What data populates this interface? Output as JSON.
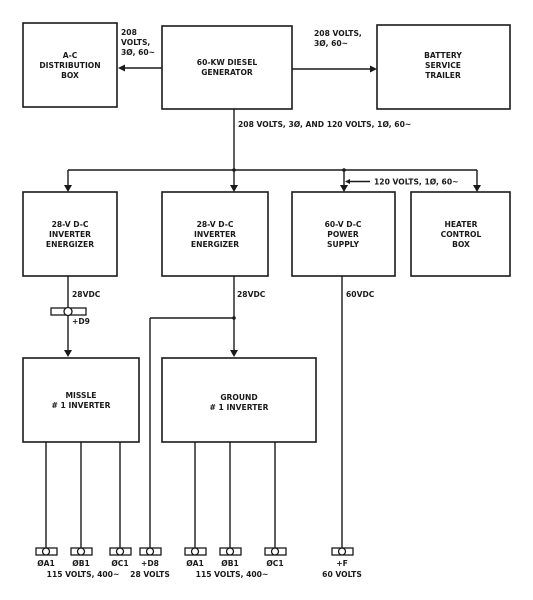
{
  "diagram": {
    "blocks": {
      "ac_box": [
        "A-C",
        "DISTRIBUTION",
        "BOX"
      ],
      "generator": [
        "60-KW DIESEL",
        "GENERATOR"
      ],
      "battery": [
        "BATTERY",
        "SERVICE",
        "TRAILER"
      ],
      "inverter_energizer_1": [
        "28-V D-C",
        "INVERTER",
        "ENERGIZER"
      ],
      "inverter_energizer_2": [
        "28-V D-C",
        "INVERTER",
        "ENERGIZER"
      ],
      "power_supply": [
        "60-V D-C",
        "POWER",
        "SUPPLY"
      ],
      "heater": [
        "HEATER",
        "CONTROL",
        "BOX"
      ],
      "missle_inverter": [
        "MISSLE",
        "# 1 INVERTER"
      ],
      "ground_inverter": [
        "GROUND",
        "# 1 INVERTER"
      ]
    },
    "labels": {
      "gen_to_ac": [
        "208",
        "VOLTS,",
        "3Ø, 60~"
      ],
      "gen_to_battery": [
        "208 VOLTS,",
        "3Ø, 60~"
      ],
      "main_bus": "208 VOLTS, 3Ø, AND 120 VOLTS, 1Ø, 60~",
      "power_supply_feed": "120 VOLTS, 1Ø, 60~",
      "energizer1_out": "28VDC",
      "energizer2_out": "28VDC",
      "power_supply_out": "60VDC",
      "d9_terminal": "+D9"
    },
    "terminals": [
      {
        "id": "missle-a1",
        "label": "ØA1"
      },
      {
        "id": "missle-b1",
        "label": "ØB1"
      },
      {
        "id": "missle-c1",
        "label": "ØC1"
      },
      {
        "id": "d8",
        "label": "+D8"
      },
      {
        "id": "ground-a1",
        "label": "ØA1"
      },
      {
        "id": "ground-b1",
        "label": "ØB1"
      },
      {
        "id": "ground-c1",
        "label": "ØC1"
      },
      {
        "id": "f",
        "label": "+F"
      }
    ],
    "terminal_groups": {
      "missle_output": "115 VOLTS, 400~",
      "d8_output": "28 VOLTS",
      "ground_output": "115 VOLTS, 400~",
      "f_output": "60 VOLTS"
    }
  }
}
